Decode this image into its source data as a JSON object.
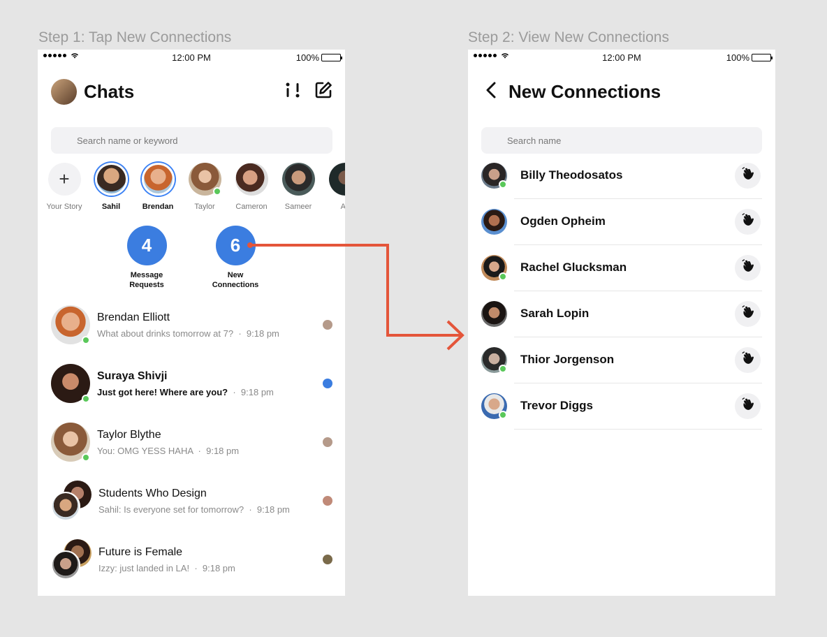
{
  "steps": {
    "step1_title": "Step 1: Tap New Connections",
    "step2_title": "Step 2: View New Connections"
  },
  "status_bar": {
    "time": "12:00 PM",
    "battery": "100%"
  },
  "phone1": {
    "title": "Chats",
    "search_placeholder": "Search name or keyword",
    "stories": [
      {
        "name": "Your Story",
        "bold": false
      },
      {
        "name": "Sahil",
        "bold": true
      },
      {
        "name": "Brendan",
        "bold": true
      },
      {
        "name": "Taylor",
        "bold": false
      },
      {
        "name": "Cameron",
        "bold": false
      },
      {
        "name": "Sameer",
        "bold": false
      },
      {
        "name": "As",
        "bold": false
      }
    ],
    "message_requests": {
      "count": "4",
      "label_line1": "Message",
      "label_line2": "Requests"
    },
    "new_connections": {
      "count": "6",
      "label_line1": "New",
      "label_line2": "Connections"
    },
    "chats": [
      {
        "name": "Brendan Elliott",
        "preview": "What about drinks tomorrow at 7?",
        "time": "9:18 pm",
        "unread": false
      },
      {
        "name": "Suraya Shivji",
        "preview": "Just got here! Where are you?",
        "time": "9:18 pm",
        "unread": true
      },
      {
        "name": "Taylor Blythe",
        "preview": "You: OMG YESS HAHA",
        "time": "9:18 pm",
        "unread": false
      },
      {
        "name": "Students Who Design",
        "preview": "Sahil: Is everyone set for tomorrow?",
        "time": "9:18 pm",
        "unread": false
      },
      {
        "name": "Future is Female",
        "preview": "Izzy: just landed in LA!",
        "time": "9:18 pm",
        "unread": false
      }
    ],
    "separator": "·"
  },
  "phone2": {
    "title": "New Connections",
    "search_placeholder": "Search name",
    "connections": [
      {
        "name": "Billy Theodosatos"
      },
      {
        "name": "Ogden Opheim"
      },
      {
        "name": "Rachel Glucksman"
      },
      {
        "name": "Sarah Lopin"
      },
      {
        "name": "Thior Jorgenson"
      },
      {
        "name": "Trevor Diggs"
      }
    ]
  },
  "colors": {
    "accent": "#3b7de0",
    "online": "#5ac85a",
    "arrow": "#e4553a"
  }
}
